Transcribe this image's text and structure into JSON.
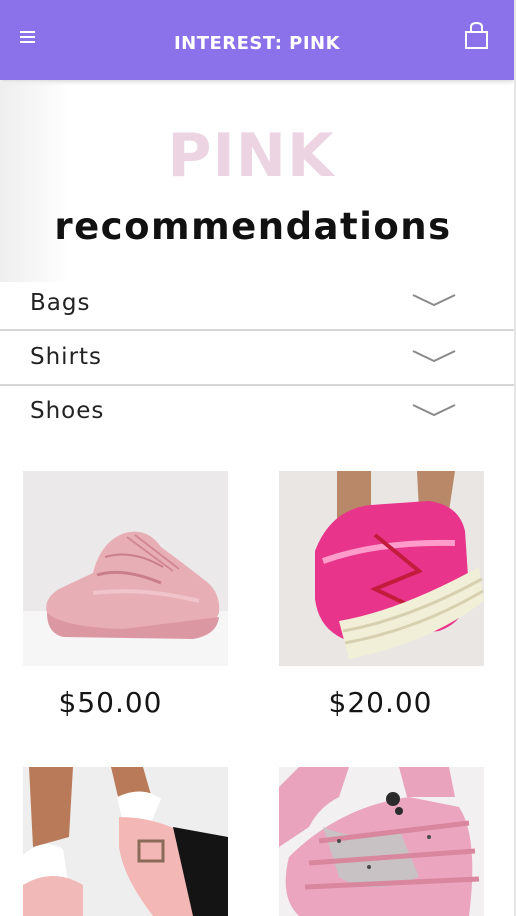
{
  "header": {
    "title": "INTEREST: PINK",
    "menu_icon": "menu-icon",
    "bag_icon": "shopping-bag-icon",
    "color": "#8c72ea"
  },
  "hero": {
    "title": "PINK",
    "subtitle": "recommendations",
    "title_color": "#ecd4e3"
  },
  "categories": [
    {
      "label": "Bags",
      "icon": "chevron-down-icon"
    },
    {
      "label": "Shirts",
      "icon": "chevron-down-icon"
    },
    {
      "label": "Shoes",
      "icon": "chevron-down-icon"
    }
  ],
  "products": [
    {
      "price": "$50.00",
      "image": "pink chunky sneaker"
    },
    {
      "price": "$20.00",
      "image": "hot pink metallic platform high-top"
    },
    {
      "image": "light pink mary jane platform shoe with frilly socks"
    },
    {
      "image": "pink strappy platform wedge"
    }
  ]
}
